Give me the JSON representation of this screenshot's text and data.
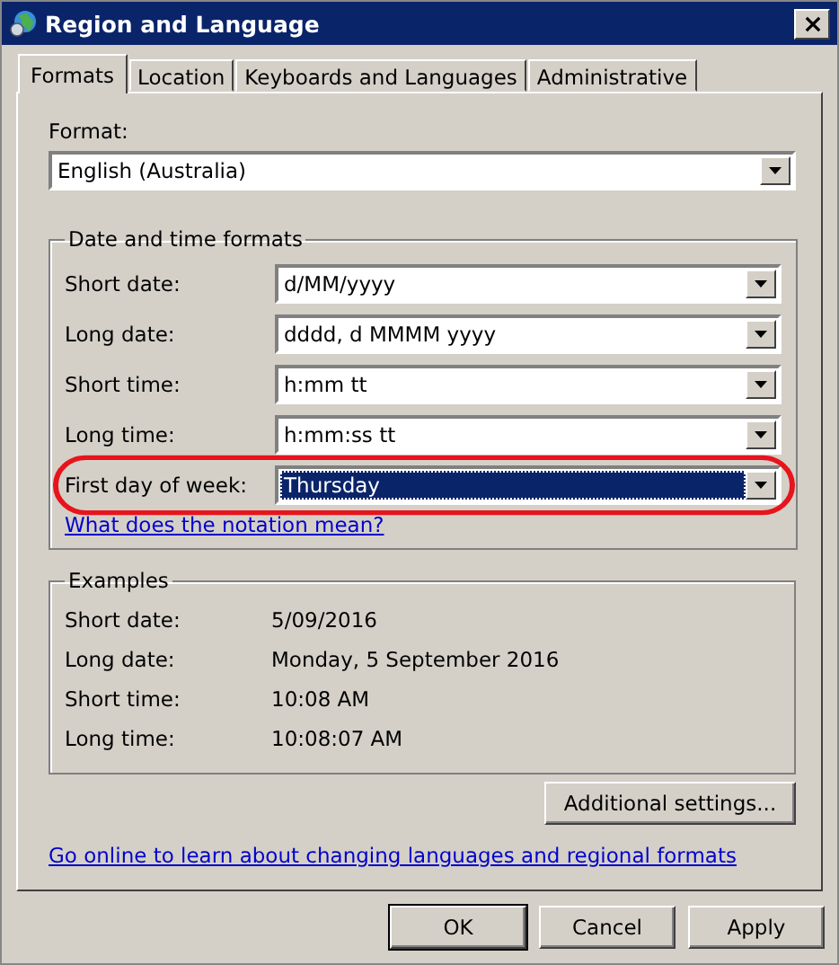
{
  "window": {
    "title": "Region and Language"
  },
  "tabs": [
    {
      "label": "Formats",
      "selected": true
    },
    {
      "label": "Location",
      "selected": false
    },
    {
      "label": "Keyboards and Languages",
      "selected": false
    },
    {
      "label": "Administrative",
      "selected": false
    }
  ],
  "format": {
    "label": "Format:",
    "value": "English (Australia)"
  },
  "date_time_formats": {
    "title": "Date and time formats",
    "fields": [
      {
        "label": "Short date:",
        "value": "d/MM/yyyy",
        "focused": false,
        "circled": false
      },
      {
        "label": "Long date:",
        "value": "dddd, d MMMM yyyy",
        "focused": false,
        "circled": false
      },
      {
        "label": "Short time:",
        "value": "h:mm tt",
        "focused": false,
        "circled": false
      },
      {
        "label": "Long time:",
        "value": "h:mm:ss tt",
        "focused": false,
        "circled": false
      },
      {
        "label": "First day of week:",
        "value": "Thursday",
        "focused": true,
        "circled": true
      }
    ],
    "link": "What does the notation mean?"
  },
  "examples": {
    "title": "Examples",
    "rows": [
      {
        "label": "Short date:",
        "value": "5/09/2016"
      },
      {
        "label": "Long date:",
        "value": "Monday, 5 September 2016"
      },
      {
        "label": "Short time:",
        "value": "10:08 AM"
      },
      {
        "label": "Long time:",
        "value": "10:08:07 AM"
      }
    ]
  },
  "additional_button": "Additional settings...",
  "online_link": "Go online to learn about changing languages and regional formats",
  "buttons": [
    "OK",
    "Cancel",
    "Apply"
  ]
}
